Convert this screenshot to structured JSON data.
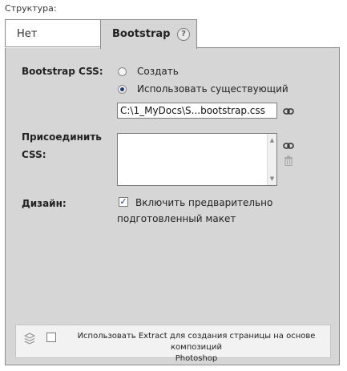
{
  "section_label": "Структура:",
  "tabs": [
    {
      "label": "Нет",
      "active": false
    },
    {
      "label": "Bootstrap",
      "active": true
    }
  ],
  "help_icon_glyph": "?",
  "bootstrap_css": {
    "label": "Bootstrap CSS:",
    "options": [
      {
        "label": "Создать",
        "selected": false
      },
      {
        "label": "Использовать существующий",
        "selected": true
      }
    ],
    "path_value": "C:\\1_MyDocs\\S...bootstrap.css"
  },
  "attach_css": {
    "label_line1": "Присоединить",
    "label_line2": "CSS:",
    "value": ""
  },
  "design": {
    "label": "Дизайн:",
    "checkbox_checked": true,
    "checkbox_mark": "✓",
    "option_line1": "Включить предварительно",
    "option_line2": "подготовленный макет"
  },
  "extract": {
    "checkbox_checked": false,
    "text_line1": "Использовать Extract для создания страницы на основе композиций",
    "text_line2": "Photoshop"
  },
  "icons": {
    "link": "link-icon",
    "trash": "trash-icon",
    "layers": "layers-icon",
    "help": "question-circle-icon"
  },
  "colors": {
    "panel_bg": "#d6d6d6",
    "border": "#8a8a8a",
    "radio_dot": "#1d3b7a",
    "extract_bg": "#f2f2f2"
  }
}
